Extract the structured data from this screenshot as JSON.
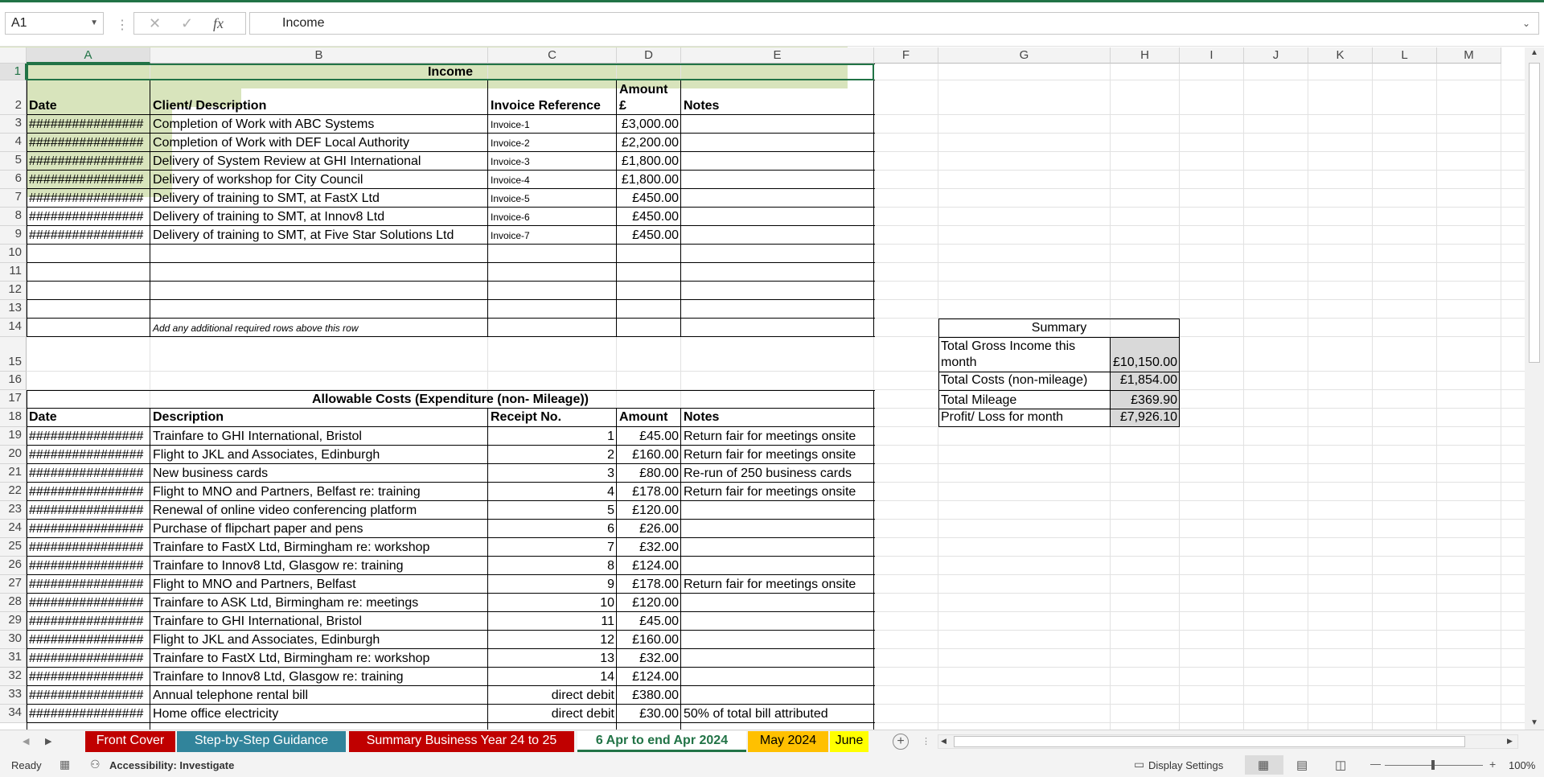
{
  "formula_bar": {
    "name_box": "A1",
    "cancel_icon": "✕",
    "enter_icon": "✓",
    "fx_label": "fx",
    "formula": "Income"
  },
  "columns": [
    "A",
    "B",
    "C",
    "D",
    "E",
    "F",
    "G",
    "H",
    "I",
    "J",
    "K",
    "L",
    "M"
  ],
  "rows": [
    "1",
    "2",
    "3",
    "4",
    "5",
    "6",
    "7",
    "8",
    "9",
    "10",
    "11",
    "12",
    "13",
    "14",
    "15",
    "16",
    "17",
    "18",
    "19",
    "20",
    "21",
    "22",
    "23",
    "24",
    "25",
    "26",
    "27",
    "28",
    "29",
    "30",
    "31",
    "32",
    "33",
    "34"
  ],
  "income": {
    "title": "Income",
    "headers": [
      "Date",
      "Client/ Description",
      "Invoice Reference",
      "Amount £",
      "Notes"
    ],
    "header_amount_line1": "Amount",
    "header_amount_line2": "£",
    "rows": [
      {
        "date": "################",
        "desc": "Completion of Work with ABC Systems",
        "ref": "Invoice-1",
        "amount": "£3,000.00",
        "notes": ""
      },
      {
        "date": "################",
        "desc": "Completion of Work with DEF Local Authority",
        "ref": "Invoice-2",
        "amount": "£2,200.00",
        "notes": ""
      },
      {
        "date": "################",
        "desc": "Delivery of System Review at GHI International",
        "ref": "Invoice-3",
        "amount": "£1,800.00",
        "notes": ""
      },
      {
        "date": "################",
        "desc": "Delivery of workshop for City Council",
        "ref": "Invoice-4",
        "amount": "£1,800.00",
        "notes": ""
      },
      {
        "date": "################",
        "desc": "Delivery of training to SMT, at FastX Ltd",
        "ref": "Invoice-5",
        "amount": "£450.00",
        "notes": ""
      },
      {
        "date": "################",
        "desc": "Delivery of training to SMT, at Innov8 Ltd",
        "ref": "Invoice-6",
        "amount": "£450.00",
        "notes": ""
      },
      {
        "date": "################",
        "desc": "Delivery of training to SMT, at Five Star Solutions Ltd",
        "ref": "Invoice-7",
        "amount": "£450.00",
        "notes": ""
      }
    ],
    "add_rows_note": "Add any additional required rows above this row"
  },
  "summary": {
    "title": "Summary",
    "gross_label_1": "Total Gross Income this",
    "gross_label_2": "month",
    "gross_value": "£10,150.00",
    "costs_label": "Total Costs (non-mileage)",
    "costs_value": "£1,854.00",
    "mileage_label": "Total Mileage",
    "mileage_value": "£369.90",
    "profit_label": "Profit/ Loss for month",
    "profit_value": "£7,926.10"
  },
  "costs": {
    "title": "Allowable Costs (Expenditure (non- Mileage))",
    "headers": [
      "Date",
      "Description",
      "Receipt No.",
      "Amount",
      "Notes"
    ],
    "rows": [
      {
        "date": "################",
        "desc": "Trainfare to GHI International, Bristol",
        "receipt": "1",
        "amount": "£45.00",
        "notes": "Return fair for meetings onsite"
      },
      {
        "date": "################",
        "desc": "Flight to JKL and Associates, Edinburgh",
        "receipt": "2",
        "amount": "£160.00",
        "notes": "Return fair for meetings onsite"
      },
      {
        "date": "################",
        "desc": "New business cards",
        "receipt": "3",
        "amount": "£80.00",
        "notes": "Re-run of 250 business cards"
      },
      {
        "date": "################",
        "desc": "Flight to MNO and Partners, Belfast re: training",
        "receipt": "4",
        "amount": "£178.00",
        "notes": "Return fair for meetings onsite"
      },
      {
        "date": "################",
        "desc": "Renewal of online video conferencing platform",
        "receipt": "5",
        "amount": "£120.00",
        "notes": ""
      },
      {
        "date": "################",
        "desc": "Purchase of flipchart paper and pens",
        "receipt": "6",
        "amount": "£26.00",
        "notes": ""
      },
      {
        "date": "################",
        "desc": "Trainfare to FastX Ltd, Birmingham re: workshop",
        "receipt": "7",
        "amount": "£32.00",
        "notes": ""
      },
      {
        "date": "################",
        "desc": "Trainfare to Innov8 Ltd, Glasgow re: training",
        "receipt": "8",
        "amount": "£124.00",
        "notes": ""
      },
      {
        "date": "################",
        "desc": "Flight to MNO and Partners, Belfast",
        "receipt": "9",
        "amount": "£178.00",
        "notes": "Return fair for meetings onsite"
      },
      {
        "date": "################",
        "desc": "Trainfare to ASK Ltd, Birmingham re: meetings",
        "receipt": "10",
        "amount": "£120.00",
        "notes": ""
      },
      {
        "date": "################",
        "desc": "Trainfare to GHI International, Bristol",
        "receipt": "11",
        "amount": "£45.00",
        "notes": ""
      },
      {
        "date": "################",
        "desc": "Flight to JKL and Associates, Edinburgh",
        "receipt": "12",
        "amount": "£160.00",
        "notes": ""
      },
      {
        "date": "################",
        "desc": "Trainfare to FastX Ltd, Birmingham re: workshop",
        "receipt": "13",
        "amount": "£32.00",
        "notes": ""
      },
      {
        "date": "################",
        "desc": "Trainfare to Innov8 Ltd, Glasgow re: training",
        "receipt": "14",
        "amount": "£124.00",
        "notes": ""
      },
      {
        "date": "################",
        "desc": "Annual telephone rental bill",
        "receipt": "direct debit",
        "amount": "£380.00",
        "notes": ""
      },
      {
        "date": "################",
        "desc": "Home office electricity",
        "receipt": "direct debit",
        "amount": "£30.00",
        "notes": "50% of total bill attributed"
      }
    ]
  },
  "sheet_tabs": [
    {
      "label": "Front Cover",
      "color": "#c00000"
    },
    {
      "label": "Step-by-Step Guidance",
      "color": "#31849b"
    },
    {
      "label": "Summary Business Year 24 to 25",
      "color": "#c00000"
    },
    {
      "label": "6 Apr to end Apr 2024",
      "color": "#ffffff",
      "active": true
    },
    {
      "label": "May 2024",
      "color": "#ffc000"
    },
    {
      "label": "June ...",
      "color": "#ffff00"
    }
  ],
  "status_bar": {
    "ready": "Ready",
    "accessibility": "Accessibility: Investigate",
    "display_settings": "Display Settings",
    "zoom_minus": "—",
    "zoom_plus": "+",
    "zoom": "100%"
  }
}
